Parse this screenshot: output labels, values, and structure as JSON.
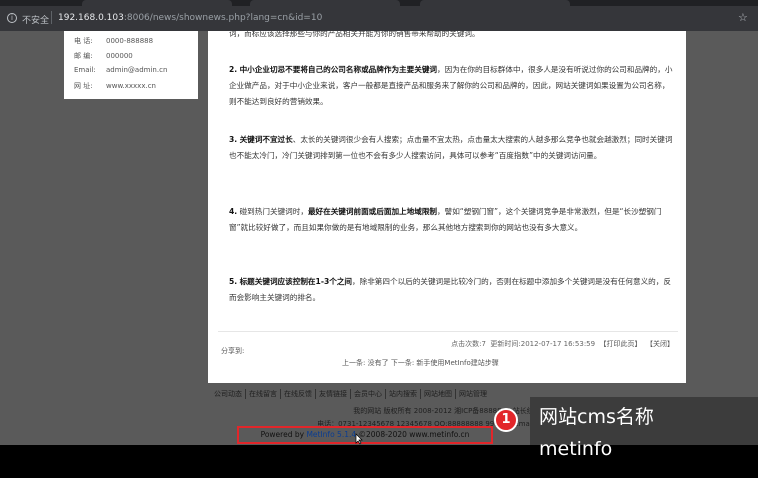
{
  "browser": {
    "security_label": "不安全",
    "url_host": "192.168.0.103",
    "url_rest": ":8006/news/shownews.php?lang=cn&id=10"
  },
  "contact": {
    "rows": [
      {
        "key": "电  话:",
        "value": "0000-888888"
      },
      {
        "key": "邮  编:",
        "value": "000000"
      },
      {
        "key": "Email:",
        "value": "admin@admin.cn"
      },
      {
        "key": "网  址:",
        "value": "www.xxxxx.cn"
      }
    ]
  },
  "article": {
    "top_fragment": "词，而标应该选择那些与你的产品相关并能为你的销售带来帮助的关键词。",
    "p2": {
      "num": "2.",
      "bold": "中小企业切忌不要将自己的公司名称或品牌作为主要关键词",
      "rest": "，因为在你的目标群体中，很多人是没有听说过你的公司和品牌的，小企业做产品，对于中小企业来说，客户一般都是直接产品和服务来了解你的公司和品牌的，因此，网站关键词如果设置为公司名称，则不能达到良好的营销效果。"
    },
    "p3": {
      "num": "3.",
      "bold": "关键词不宜过长",
      "rest": "、太长的关键词很少会有人搜索；点击量不宜太热，点击量太大搜索的人越多那么竞争也就会越激烈；同时关键词也不能太冷门，冷门关键词排到第一位也不会有多少人搜索访问，具体可以参考“百度指数”中的关键词访问量。"
    },
    "p4": {
      "num": "4.",
      "text1": "碰到热门关键词时，",
      "bold": "最好在关键词前面或后面加上地域限制",
      "rest": "，譬如“塑钢门窗”，这个关键词竞争是非常激烈，但是“长沙塑钢门窗”就比较好做了，而且如果你做的是有地域限制的业务，那么其他地方搜索到你的网站也没有多大意义。"
    },
    "p5": {
      "num": "5.",
      "bold": "标题关键词应该控制在1-3个之间",
      "rest": "，除非第四个以后的关键词是比较冷门的，否则在标题中添加多个关键词是没有任何意义的，反而会影响主关键词的排名。"
    },
    "share_label": "分享到:",
    "meta": {
      "clicks_label": "点击次数:",
      "clicks": "7",
      "updated_label": "更新时间:",
      "updated": "2012-07-17 16:53:59",
      "print": "【打印此页】",
      "close": "【关闭】"
    },
    "prevnext": {
      "prev_label": "上一条:",
      "prev_value": "没有了",
      "next_label": "下一条:",
      "next_value": "新手使用MetInfo建站步骤"
    }
  },
  "footer": {
    "nav": [
      "公司动态",
      "在线留言",
      "在线反馈",
      "友情链接",
      "会员中心",
      "站内搜索",
      "网站地图",
      "网站管理"
    ],
    "copyright": "我的网站 版权所有 2008-2012 湘ICP备8888888 站长统计",
    "contact_line": "电话：0731-12345678 12345678 QQ:88888888 999999 Email:metinfo@m",
    "powered_prefix": "Powered by",
    "powered_version": "MetInfo 5.1.4",
    "powered_suffix": "©2008-2020  www.metinfo.cn"
  },
  "overlay": {
    "badge": "1",
    "line1": "网站cms名称",
    "line2": "metinfo"
  }
}
